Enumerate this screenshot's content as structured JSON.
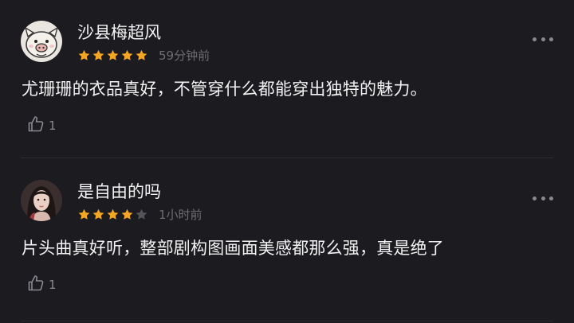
{
  "comments": [
    {
      "username": "沙县梅超风",
      "rating": 5,
      "time": "59分钟前",
      "text": "尤珊珊的衣品真好，不管穿什么都能穿出独特的魅力。",
      "likes": "1",
      "avatar_icon": "pig-cartoon-avatar"
    },
    {
      "username": "是自由的吗",
      "rating": 4,
      "time": "1小时前",
      "text": "片头曲真好听，整部剧构图画面美感都那么强，真是绝了",
      "likes": "1",
      "avatar_icon": "woman-portrait-avatar"
    }
  ],
  "colors": {
    "background": "#1c1b20",
    "star_filled": "#f3a623",
    "star_empty": "#55545a",
    "text_primary": "#f2f2f2",
    "text_secondary": "#6e6d72"
  }
}
